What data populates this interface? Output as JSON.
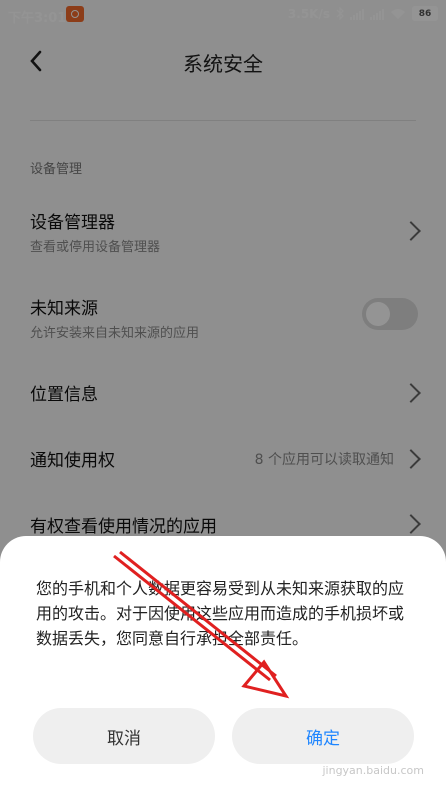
{
  "status_bar": {
    "time": "下午3:01",
    "net_speed": "3.5K/s",
    "battery": "86",
    "icons": [
      "app-notification-icon",
      "bluetooth-icon",
      "signal-icon",
      "signal-icon",
      "wifi-icon",
      "battery-icon"
    ]
  },
  "header": {
    "title": "系统安全",
    "back_icon": "chevron-left-icon"
  },
  "section": {
    "label": "设备管理"
  },
  "rows": [
    {
      "title": "设备管理器",
      "subtitle": "查看或停用设备管理器",
      "has_chevron": true
    },
    {
      "title": "未知来源",
      "subtitle": "允许安装来自未知来源的应用",
      "toggle_on": false
    },
    {
      "title": "位置信息",
      "has_chevron": true
    },
    {
      "title": "通知使用权",
      "value": "8 个应用可以读取通知",
      "has_chevron": true
    },
    {
      "title": "有权查看使用情况的应用",
      "has_chevron": true
    }
  ],
  "dialog": {
    "message": "您的手机和个人数据更容易受到从未知来源获取的应用的攻击。对于因使用这些应用而造成的手机损坏或数据丢失，您同意自行承担全部责任。",
    "cancel_label": "取消",
    "confirm_label": "确定"
  },
  "annotation": {
    "color": "#e02020",
    "type": "arrow"
  },
  "colors": {
    "confirm_text": "#1f86ff",
    "dim_overlay": "rgba(0,0,0,0.42)"
  },
  "watermark": "jingyan.baidu.com"
}
